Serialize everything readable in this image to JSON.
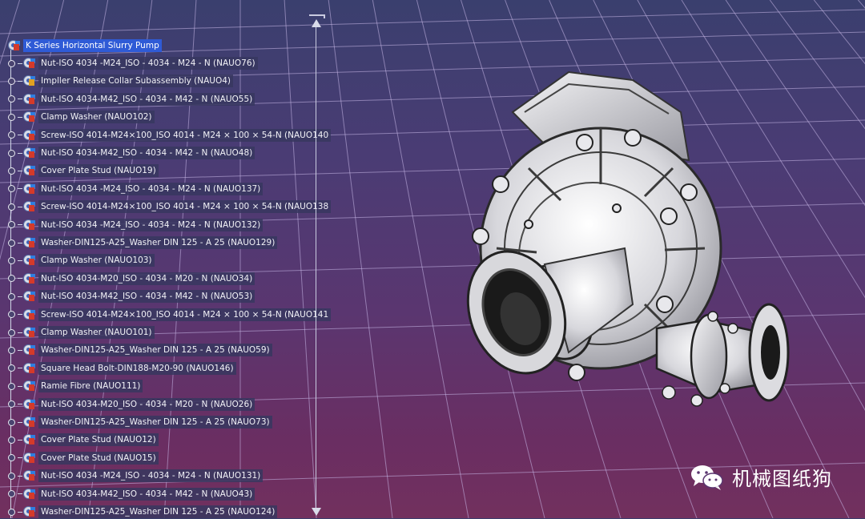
{
  "tree": {
    "root_label": "K Series Horizontal Slurry Pump",
    "items": [
      {
        "label": "Nut-ISO 4034 -M24_ISO - 4034 - M24 - N (NAUO76)",
        "icon": "part-icon"
      },
      {
        "label": "Impller Release Collar Subassembly (NAUO4)",
        "icon": "subassembly-icon"
      },
      {
        "label": "Nut-ISO 4034-M42_ISO - 4034 - M42 - N (NAUO55)",
        "icon": "part-icon"
      },
      {
        "label": "Clamp Washer (NAUO102)",
        "icon": "part-icon"
      },
      {
        "label": "Screw-ISO 4014-M24×100_ISO 4014 - M24 × 100 × 54-N (NAUO140",
        "icon": "part-icon"
      },
      {
        "label": "Nut-ISO 4034-M42_ISO - 4034 - M42 - N (NAUO48)",
        "icon": "part-icon"
      },
      {
        "label": "Cover Plate Stud (NAUO19)",
        "icon": "part-icon"
      },
      {
        "label": "Nut-ISO 4034 -M24_ISO - 4034 - M24 - N (NAUO137)",
        "icon": "part-icon"
      },
      {
        "label": "Screw-ISO 4014-M24×100_ISO 4014 - M24 × 100 × 54-N (NAUO138",
        "icon": "part-icon"
      },
      {
        "label": "Nut-ISO 4034 -M24_ISO - 4034 - M24 - N (NAUO132)",
        "icon": "part-icon"
      },
      {
        "label": "Washer-DIN125-A25_Washer DIN 125 - A 25 (NAUO129)",
        "icon": "part-icon"
      },
      {
        "label": "Clamp Washer (NAUO103)",
        "icon": "part-icon"
      },
      {
        "label": "Nut-ISO 4034-M20_ISO - 4034 - M20 - N (NAUO34)",
        "icon": "part-icon"
      },
      {
        "label": "Nut-ISO 4034-M42_ISO - 4034 - M42 - N (NAUO53)",
        "icon": "part-icon"
      },
      {
        "label": "Screw-ISO 4014-M24×100_ISO 4014 - M24 × 100 × 54-N (NAUO141",
        "icon": "part-icon"
      },
      {
        "label": "Clamp Washer (NAUO101)",
        "icon": "part-icon"
      },
      {
        "label": "Washer-DIN125-A25_Washer DIN 125 - A 25 (NAUO59)",
        "icon": "part-icon"
      },
      {
        "label": "Square Head Bolt-DIN188-M20-90 (NAUO146)",
        "icon": "part-icon"
      },
      {
        "label": "Ramie Fibre (NAUO111)",
        "icon": "part-icon"
      },
      {
        "label": "Nut-ISO 4034-M20_ISO - 4034 - M20 - N (NAUO26)",
        "icon": "part-icon"
      },
      {
        "label": "Washer-DIN125-A25_Washer DIN 125 - A 25 (NAUO73)",
        "icon": "part-icon"
      },
      {
        "label": "Cover Plate Stud (NAUO12)",
        "icon": "part-icon"
      },
      {
        "label": "Cover Plate Stud (NAUO15)",
        "icon": "part-icon"
      },
      {
        "label": "Nut-ISO 4034 -M24_ISO - 4034 - M24 - N (NAUO131)",
        "icon": "part-icon"
      },
      {
        "label": "Nut-ISO 4034-M42_ISO - 4034 - M42 - N (NAUO43)",
        "icon": "part-icon"
      },
      {
        "label": "Washer-DIN125-A25_Washer DIN 125 - A 25 (NAUO124)",
        "icon": "part-icon"
      }
    ]
  },
  "watermark": {
    "text": "机械图纸狗",
    "icon": "wechat-icon"
  },
  "colors": {
    "background_top": "#3a3f6e",
    "background_bottom": "#72305e",
    "grid_line": "#c8b8e8",
    "selection": "#2f5bd6"
  }
}
